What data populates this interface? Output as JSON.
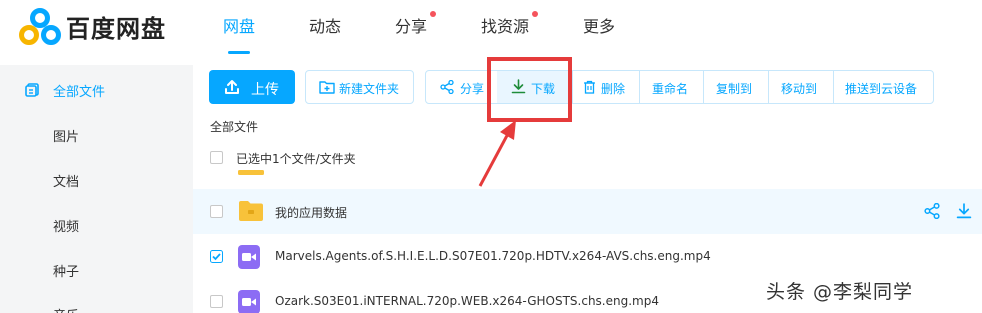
{
  "app": {
    "brand": "百度网盘"
  },
  "nav": {
    "items": [
      {
        "label": "网盘",
        "active": true
      },
      {
        "label": "动态",
        "active": false
      },
      {
        "label": "分享",
        "active": false,
        "dot": true
      },
      {
        "label": "找资源",
        "active": false,
        "dot": true
      },
      {
        "label": "更多",
        "active": false
      }
    ]
  },
  "sidebar": {
    "items": [
      {
        "label": "全部文件",
        "active": true
      },
      {
        "label": "图片"
      },
      {
        "label": "文档"
      },
      {
        "label": "视频"
      },
      {
        "label": "种子"
      },
      {
        "label": "音乐"
      }
    ]
  },
  "toolbar": {
    "upload": "上传",
    "new_folder": "新建文件夹",
    "share": "分享",
    "download": "下载",
    "delete": "删除",
    "rename": "重命名",
    "copy_to": "复制到",
    "move_to": "移动到",
    "push_to_cloud": "推送到云设备"
  },
  "breadcrumb": "全部文件",
  "selection_text": "已选中1个文件/文件夹",
  "files": [
    {
      "name": "我的应用数据",
      "type": "folder",
      "checked": false
    },
    {
      "name": "Marvels.Agents.of.S.H.I.E.L.D.S07E01.720p.HDTV.x264-AVS.chs.eng.mp4",
      "type": "video",
      "checked": true
    },
    {
      "name": "Ozark.S03E01.iNTERNAL.720p.WEB.x264-GHOSTS.chs.eng.mp4",
      "type": "video",
      "checked": false
    }
  ],
  "watermark": "头条 @李梨同学",
  "colors": {
    "accent": "#06a7ff",
    "annotation": "#e53b3b",
    "folder": "#f8c23a",
    "video": "#8c6cf4"
  }
}
